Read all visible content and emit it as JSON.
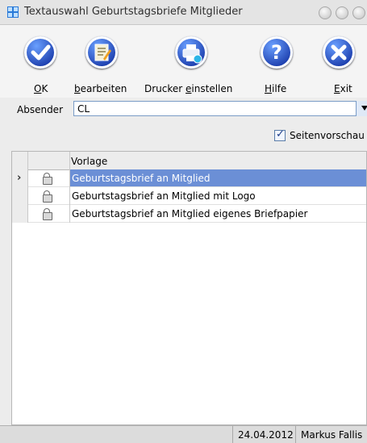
{
  "window": {
    "title": "Textauswahl Geburtstagsbriefe Mitglieder"
  },
  "toolbar": {
    "buttons": [
      {
        "icon": "check-icon",
        "label_pre": "",
        "label_ul": "O",
        "label_post": "K"
      },
      {
        "icon": "edit-document-icon",
        "label_pre": "",
        "label_ul": "b",
        "label_post": "earbeiten"
      },
      {
        "icon": "printer-icon",
        "label_pre": "Drucker ",
        "label_ul": "e",
        "label_post": "instellen"
      },
      {
        "icon": "help-icon",
        "label_pre": "",
        "label_ul": "H",
        "label_post": "ilfe"
      },
      {
        "icon": "exit-icon",
        "label_pre": "",
        "label_ul": "E",
        "label_post": "xit"
      }
    ]
  },
  "absender": {
    "label": "Absender",
    "value": "CL"
  },
  "seitenvorschau": {
    "label": "Seitenvorschau",
    "checked": true
  },
  "grid": {
    "column_header": "Vorlage",
    "rows": [
      {
        "name": "Geburtstagsbrief an Mitglied",
        "selected": true
      },
      {
        "name": "Geburtstagsbrief an Mitglied mit Logo",
        "selected": false
      },
      {
        "name": "Geburtstagsbrief an Mitglied eigenes Briefpapier",
        "selected": false
      }
    ]
  },
  "status": {
    "date": "24.04.2012",
    "user": "Markus Fallis"
  },
  "colors": {
    "selection": "#6b8fd6",
    "toolbar_icon": "#1d3fae"
  }
}
